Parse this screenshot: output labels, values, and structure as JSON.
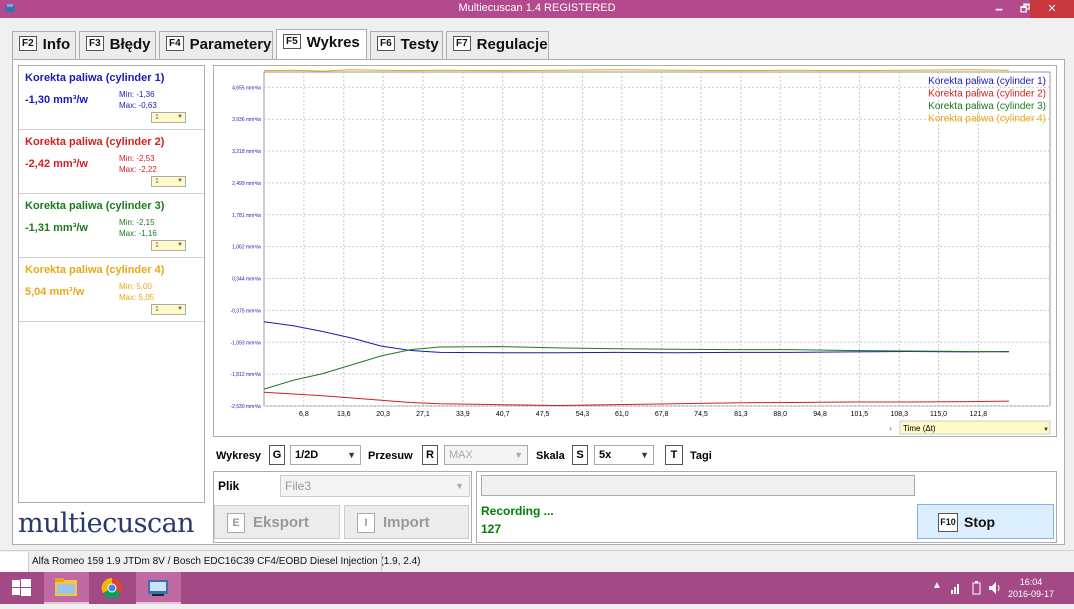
{
  "window": {
    "title": "Multiecuscan 1.4 REGISTERED",
    "minimize": "🗕",
    "maximize": "🗗",
    "close": "✕"
  },
  "tabs": [
    {
      "key": "F2",
      "label": "Info"
    },
    {
      "key": "F3",
      "label": "Błędy"
    },
    {
      "key": "F4",
      "label": "Parametery"
    },
    {
      "key": "F5",
      "label": "Wykres"
    },
    {
      "key": "F6",
      "label": "Testy"
    },
    {
      "key": "F7",
      "label": "Regulacje"
    }
  ],
  "sensors": [
    {
      "name": "Korekta paliwa (cylinder 1)",
      "value": "-1,30 mm³/w",
      "min": "Min: -1,36",
      "max": "Max: -0,63",
      "dropdown": "1",
      "color": "#1a1ab8"
    },
    {
      "name": "Korekta paliwa (cylinder 2)",
      "value": "-2,42 mm³/w",
      "min": "Min: -2,53",
      "max": "Max: -2,22",
      "dropdown": "1",
      "color": "#d42020"
    },
    {
      "name": "Korekta paliwa (cylinder 3)",
      "value": "-1,31 mm³/w",
      "min": "Min: -2,15",
      "max": "Max: -1,16",
      "dropdown": "1",
      "color": "#1d7a1d"
    },
    {
      "name": "Korekta paliwa (cylinder 4)",
      "value": "5,04 mm³/w",
      "min": "Min: 5,00",
      "max": "Max: 5,05",
      "dropdown": "1",
      "color": "#e8a818"
    }
  ],
  "chart_data": {
    "type": "line",
    "y_tick_labels": [
      "4,655 mm³/w",
      "3,936 mm³/w",
      "3,218 mm³/w",
      "2,499 mm³/w",
      "1,781 mm³/w",
      "1,062 mm³/w",
      "0,344 mm³/w",
      "-0,375 mm³/w",
      "-1,093 mm³/w",
      "-1,812 mm³/w",
      "-2,530 mm³/w"
    ],
    "y_ticks": [
      4.655,
      3.936,
      3.218,
      2.499,
      1.781,
      1.062,
      0.344,
      -0.375,
      -1.093,
      -1.812,
      -2.53
    ],
    "x_tick_labels": [
      "6,8",
      "13,6",
      "20,3",
      "27,1",
      "33,9",
      "40,7",
      "47,5",
      "54,3",
      "61,0",
      "67,8",
      "74,5",
      "81,3",
      "88,0",
      "94,8",
      "101,5",
      "108,3",
      "115,0",
      "121,8"
    ],
    "x_ticks": [
      6.8,
      13.6,
      20.3,
      27.1,
      33.9,
      40.7,
      47.5,
      54.3,
      61.0,
      67.8,
      74.5,
      81.3,
      88.0,
      94.8,
      101.5,
      108.3,
      115.0,
      121.8
    ],
    "xlim": [
      0,
      134
    ],
    "ylim": [
      -2.53,
      5.0
    ],
    "xlabel": "Time (Δt)",
    "grid": true,
    "legend_position": "top-right",
    "x": [
      0,
      5,
      10,
      15,
      20,
      25,
      30,
      40,
      50,
      60,
      70,
      80,
      90,
      100,
      110,
      120,
      127
    ],
    "series": [
      {
        "name": "Korekta paliwa (cylinder 1)",
        "color": "#1a1ab8",
        "values": [
          -0.63,
          -0.72,
          -0.85,
          -1.0,
          -1.18,
          -1.28,
          -1.32,
          -1.33,
          -1.33,
          -1.32,
          -1.33,
          -1.32,
          -1.32,
          -1.31,
          -1.3,
          -1.31,
          -1.3
        ]
      },
      {
        "name": "Korekta paliwa (cylinder 2)",
        "color": "#d42020",
        "values": [
          -2.22,
          -2.26,
          -2.3,
          -2.35,
          -2.4,
          -2.45,
          -2.48,
          -2.5,
          -2.52,
          -2.5,
          -2.48,
          -2.46,
          -2.45,
          -2.44,
          -2.44,
          -2.43,
          -2.42
        ]
      },
      {
        "name": "Korekta paliwa (cylinder 3)",
        "color": "#1d7a1d",
        "values": [
          -2.15,
          -1.95,
          -1.8,
          -1.6,
          -1.4,
          -1.26,
          -1.2,
          -1.19,
          -1.22,
          -1.24,
          -1.25,
          -1.26,
          -1.26,
          -1.28,
          -1.29,
          -1.3,
          -1.31
        ]
      },
      {
        "name": "Korekta paliwa (cylinder 4)",
        "color": "#e8a818",
        "values": [
          5.03,
          5.04,
          5.02,
          5.05,
          5.04,
          5.03,
          5.04,
          5.03,
          5.04,
          5.05,
          5.04,
          5.03,
          5.04,
          5.03,
          5.04,
          5.05,
          5.04
        ]
      }
    ]
  },
  "toolbar": {
    "wykresy_label": "Wykresy",
    "wykresy_key": "G",
    "wykresy_value": "1/2D",
    "przesuw_label": "Przesuw",
    "przesuw_key": "R",
    "przesuw_value": "MAX",
    "skala_label": "Skala",
    "skala_key": "S",
    "skala_value": "5x",
    "tagi_key": "T",
    "tagi_label": "Tagi"
  },
  "file": {
    "label": "Plik",
    "value": "File3",
    "export_key": "E",
    "export_label": "Eksport",
    "import_key": "I",
    "import_label": "Import"
  },
  "status": {
    "recording": "Recording ...",
    "count": "127",
    "stop_key": "F10",
    "stop_label": "Stop"
  },
  "brand": "multiecuscan",
  "statusbar": {
    "vehicle": "Alfa Romeo 159 1.9 JTDm 8V / Bosch EDC16C39 CF4/EOBD Diesel Injection (1.9, 2.4)"
  },
  "taskbar": {
    "time": "16:04",
    "date": "2016-09-17"
  }
}
